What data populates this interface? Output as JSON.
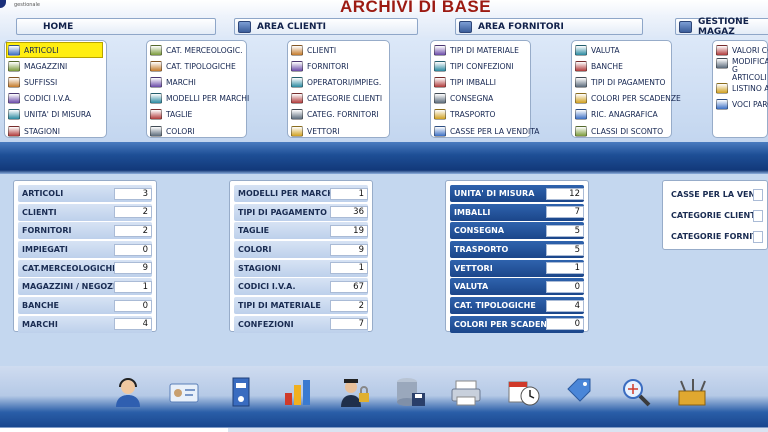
{
  "header": {
    "title": "ARCHIVI DI BASE",
    "logo_text": "gestionale"
  },
  "nav": {
    "home": "HOME",
    "clienti": "AREA CLIENTI",
    "fornitori": "AREA FORNITORI",
    "magazzino": "GESTIONE MAGAZ"
  },
  "menus": [
    {
      "items": [
        {
          "label": "ARTICOLI",
          "icon": "articles-icon",
          "selected": true
        },
        {
          "label": "MAGAZZINI",
          "icon": "warehouse-icon"
        },
        {
          "label": "SUFFISSI",
          "icon": "suffix-icon"
        },
        {
          "label": "CODICI I.V.A.",
          "icon": "vat-code-icon"
        },
        {
          "label": "UNITA' DI MISURA",
          "icon": "ruler-icon"
        },
        {
          "label": "STAGIONI",
          "icon": "season-icon"
        }
      ]
    },
    {
      "items": [
        {
          "label": "CAT. MERCEOLOGIC.",
          "icon": "category-icon"
        },
        {
          "label": "CAT. TIPOLOGICHE",
          "icon": "type-category-icon"
        },
        {
          "label": "MARCHI",
          "icon": "brand-icon"
        },
        {
          "label": "MODELLI PER MARCHI",
          "icon": "model-icon"
        },
        {
          "label": "TAGLIE",
          "icon": "size-icon"
        },
        {
          "label": "COLORI",
          "icon": "color-palette-icon"
        }
      ]
    },
    {
      "items": [
        {
          "label": "CLIENTI",
          "icon": "customer-icon"
        },
        {
          "label": "FORNITORI",
          "icon": "supplier-icon"
        },
        {
          "label": "OPERATORI/IMPIEG.",
          "icon": "operator-icon"
        },
        {
          "label": "CATEGORIE CLIENTI",
          "icon": "customer-category-icon"
        },
        {
          "label": "CATEG. FORNITORI",
          "icon": "supplier-category-icon"
        },
        {
          "label": "VETTORI",
          "icon": "carrier-icon"
        }
      ]
    },
    {
      "items": [
        {
          "label": "TIPI DI MATERIALE",
          "icon": "material-icon"
        },
        {
          "label": "TIPI CONFEZIONI",
          "icon": "package-icon"
        },
        {
          "label": "TIPI IMBALLI",
          "icon": "box-icon"
        },
        {
          "label": "CONSEGNA",
          "icon": "delivery-icon"
        },
        {
          "label": "TRASPORTO",
          "icon": "truck-icon"
        },
        {
          "label": "CASSE PER LA VENDITA",
          "icon": "cash-register-icon"
        }
      ]
    },
    {
      "items": [
        {
          "label": "VALUTA",
          "icon": "currency-icon"
        },
        {
          "label": "BANCHE",
          "icon": "bank-icon"
        },
        {
          "label": "TIPI DI PAGAMENTO",
          "icon": "payment-icon"
        },
        {
          "label": "COLORI PER SCADENZE",
          "icon": "deadline-color-icon"
        },
        {
          "label": "RIC. ANAGRAFICA",
          "icon": "search-registry-icon"
        },
        {
          "label": "CLASSI DI SCONTO",
          "icon": "discount-class-icon"
        }
      ]
    },
    {
      "items": [
        {
          "label": "VALORI COD",
          "icon": "values-icon"
        },
        {
          "label": "MODIFICA G ARTICOLI",
          "icon": "edit-articles-icon",
          "tall": true
        },
        {
          "label": "LISTINO ART",
          "icon": "price-list-icon"
        },
        {
          "label": "VOCI PARCE",
          "icon": "fee-items-icon"
        }
      ]
    }
  ],
  "counters": [
    [
      {
        "label": "ARTICOLI",
        "value": "3"
      },
      {
        "label": "CLIENTI",
        "value": "2"
      },
      {
        "label": "FORNITORI",
        "value": "2"
      },
      {
        "label": "IMPIEGATI",
        "value": "0"
      },
      {
        "label": "CAT.MERCEOLOGICHE",
        "value": "9"
      },
      {
        "label": "MAGAZZINI / NEGOZI",
        "value": "1"
      },
      {
        "label": "BANCHE",
        "value": "0"
      },
      {
        "label": "MARCHI",
        "value": "4"
      }
    ],
    [
      {
        "label": "MODELLI PER MARCHI",
        "value": "1"
      },
      {
        "label": "TIPI DI PAGAMENTO",
        "value": "36"
      },
      {
        "label": "TAGLIE",
        "value": "19"
      },
      {
        "label": "COLORI",
        "value": "9"
      },
      {
        "label": "STAGIONI",
        "value": "1"
      },
      {
        "label": "CODICI I.V.A.",
        "value": "67"
      },
      {
        "label": "TIPI DI MATERIALE",
        "value": "2"
      },
      {
        "label": "CONFEZIONI",
        "value": "7"
      }
    ],
    [
      {
        "label": "UNITA' DI MISURA",
        "value": "12"
      },
      {
        "label": "IMBALLI",
        "value": "7"
      },
      {
        "label": "CONSEGNA",
        "value": "5"
      },
      {
        "label": "TRASPORTO",
        "value": "5"
      },
      {
        "label": "VETTORI",
        "value": "1"
      },
      {
        "label": "VALUTA",
        "value": "0"
      },
      {
        "label": "CAT. TIPOLOGICHE",
        "value": "4"
      },
      {
        "label": "COLORI PER SCADENZE",
        "value": "0"
      }
    ],
    [
      {
        "label": "CASSE PER LA VENDITA",
        "value": ""
      },
      {
        "label": "CATEGORIE CLIENTI",
        "value": ""
      },
      {
        "label": "CATEGORIE FORNITORI",
        "value": ""
      }
    ]
  ],
  "toolbar": [
    "support-agent-icon",
    "id-card-icon",
    "binder-icon",
    "charts-icon",
    "security-guard-lock-icon",
    "database-save-icon",
    "printer-icon",
    "calendar-clock-icon",
    "sale-tag-icon",
    "search-web-icon",
    "tools-box-icon"
  ]
}
